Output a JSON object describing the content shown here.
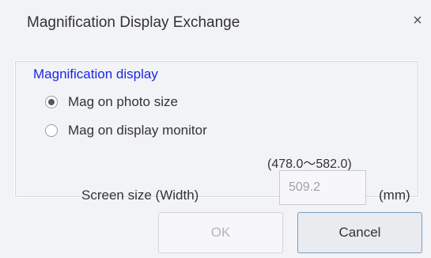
{
  "window": {
    "title": "Magnification Display Exchange",
    "close_symbol": "×"
  },
  "group": {
    "legend": "Magnification display",
    "options": [
      {
        "label": "Mag on photo size",
        "selected": true
      },
      {
        "label": "Mag on display monitor",
        "selected": false
      }
    ]
  },
  "screen_size": {
    "range": "(478.0〜582.0)",
    "label": "Screen size (Width)",
    "value": "509.2",
    "unit": "(mm)"
  },
  "buttons": {
    "ok_label": "OK",
    "cancel_label": "Cancel"
  },
  "colors": {
    "legend": "#1a28e0",
    "background": "#f2f3f7",
    "cancel_border": "#7a9cc8"
  }
}
